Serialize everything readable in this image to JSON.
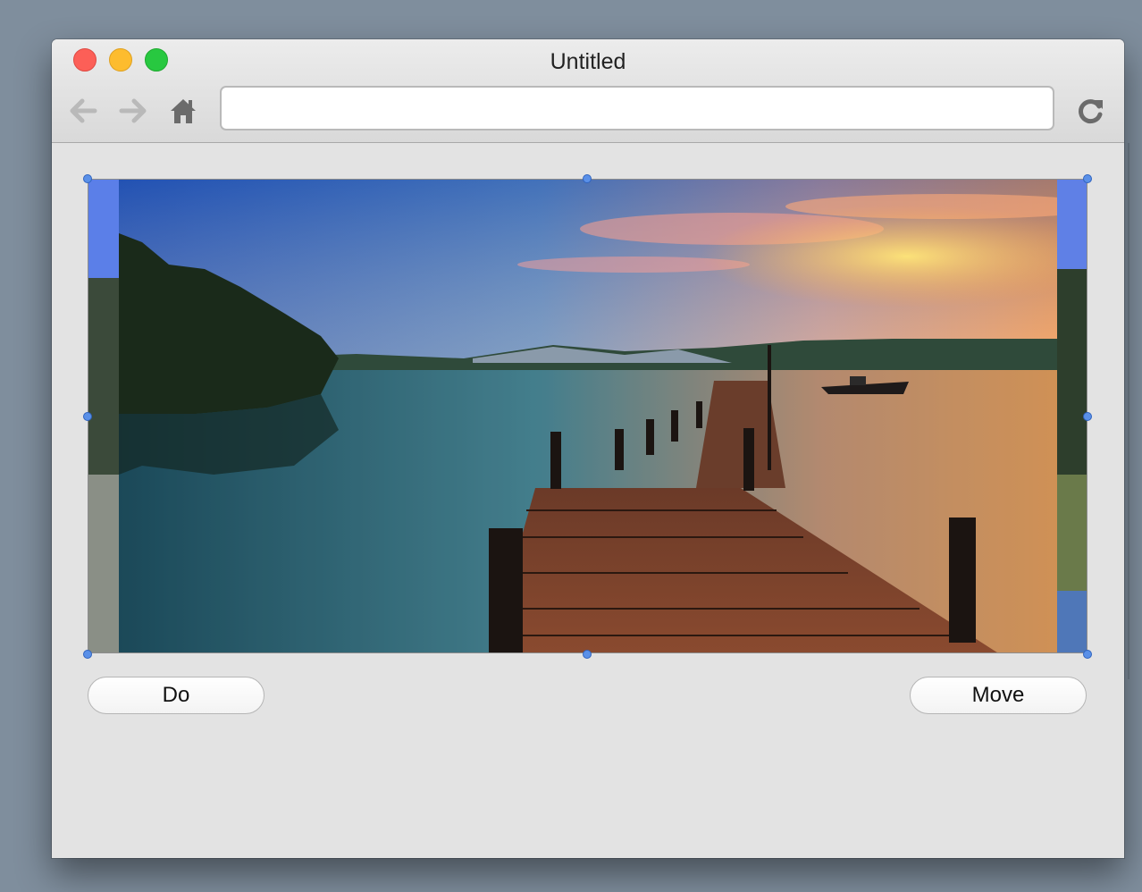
{
  "window": {
    "title": "Untitled"
  },
  "toolbar": {
    "back_icon": "arrow-left-icon",
    "forward_icon": "arrow-right-icon",
    "home_icon": "home-icon",
    "reload_icon": "reload-icon",
    "url_value": ""
  },
  "image": {
    "description_tag": "photo-pier-lake-sunset"
  },
  "buttons": {
    "do_label": "Do",
    "move_label": "Move"
  },
  "colors": {
    "selection_handle": "#5a90e8",
    "close": "#fc5f57",
    "minimize": "#fdbc2e",
    "maximize": "#28c840"
  }
}
